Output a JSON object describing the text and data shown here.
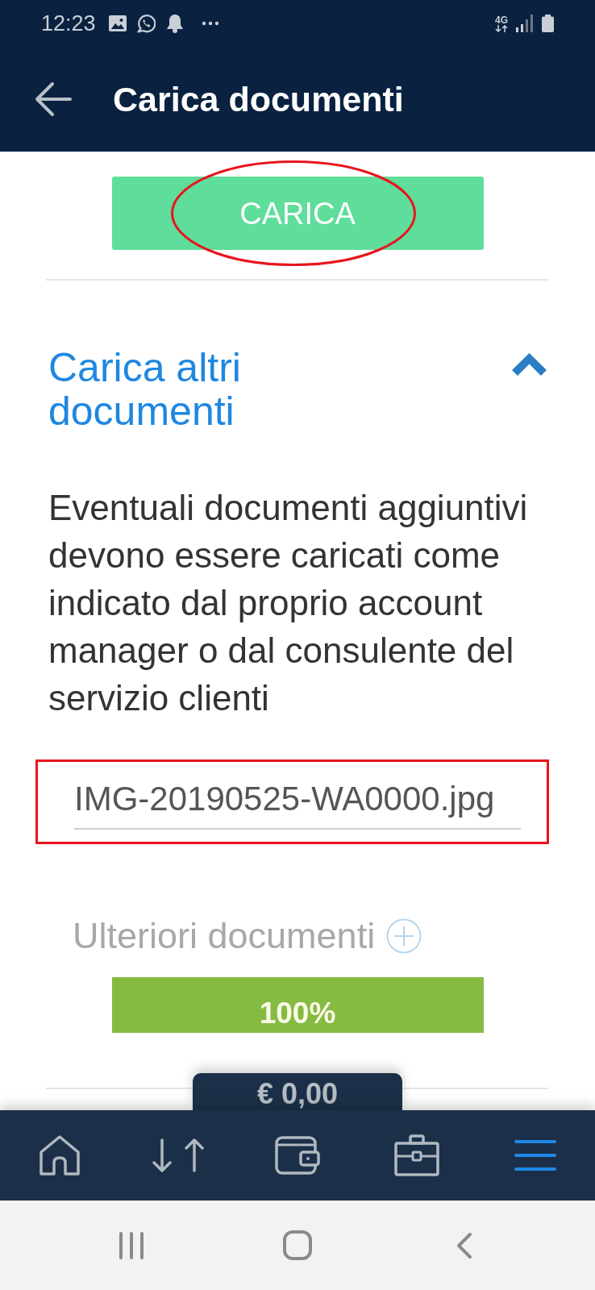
{
  "status_bar": {
    "time": "12:23",
    "network": "4G"
  },
  "header": {
    "title": "Carica documenti"
  },
  "upload_button": {
    "label": "CARICA",
    "circled": true
  },
  "section": {
    "title": "Carica altri documenti",
    "expanded": true,
    "description": "Eventuali documenti aggiuntivi devono essere caricati come indicato dal proprio account manager o dal consulente del servizio clienti",
    "file_field": {
      "value": "IMG-20190525-WA0000.jpg",
      "boxed": true
    },
    "add_more": {
      "label": "Ulteriori documenti",
      "disabled": true
    },
    "progress": {
      "level": 1,
      "reading": "100%"
    }
  },
  "bottom_nav": {
    "balance": "€ 0,00",
    "items": [
      {
        "kind": "home",
        "selected": false
      },
      {
        "kind": "transfers",
        "selected": false
      },
      {
        "kind": "wallet",
        "selected": false
      },
      {
        "kind": "briefcase",
        "selected": false
      },
      {
        "kind": "menu",
        "selected": true
      }
    ]
  }
}
